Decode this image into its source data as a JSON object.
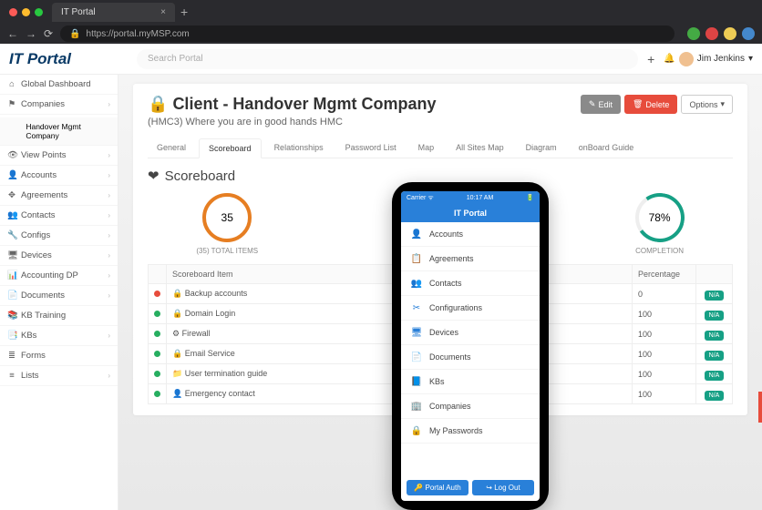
{
  "browser": {
    "tab_title": "IT Portal",
    "url": "https://portal.myMSP.com"
  },
  "header": {
    "logo": "IT Portal",
    "search_placeholder": "Search Portal",
    "add_label": "+",
    "user_name": "Jim Jenkins"
  },
  "sidebar": {
    "items": [
      {
        "icon": "⌂",
        "label": "Global Dashboard",
        "chev": false
      },
      {
        "icon": "⚑",
        "label": "Companies",
        "chev": true
      },
      {
        "icon": "",
        "label": "Handover Mgmt Company",
        "chev": false,
        "sub": true,
        "active": true
      },
      {
        "icon": "👁",
        "label": "View Points",
        "chev": true
      },
      {
        "icon": "👤",
        "label": "Accounts",
        "chev": true
      },
      {
        "icon": "✥",
        "label": "Agreements",
        "chev": true
      },
      {
        "icon": "👥",
        "label": "Contacts",
        "chev": true
      },
      {
        "icon": "🔧",
        "label": "Configs",
        "chev": true
      },
      {
        "icon": "🖥",
        "label": "Devices",
        "chev": true
      },
      {
        "icon": "📊",
        "label": "Accounting DP",
        "chev": true
      },
      {
        "icon": "📄",
        "label": "Documents",
        "chev": true
      },
      {
        "icon": "📚",
        "label": "KB Training",
        "chev": false
      },
      {
        "icon": "📑",
        "label": "KBs",
        "chev": true
      },
      {
        "icon": "≣",
        "label": "Forms",
        "chev": false
      },
      {
        "icon": "≡",
        "label": "Lists",
        "chev": true
      }
    ]
  },
  "page": {
    "lock_icon": "🔒",
    "title": "Client - Handover Mgmt Company",
    "subtitle": "(HMC3) Where you are in good hands HMC",
    "buttons": {
      "edit": "Edit",
      "delete": "Delete",
      "options": "Options"
    }
  },
  "tabs": [
    "General",
    "Scoreboard",
    "Relationships",
    "Password List",
    "Map",
    "All Sites Map",
    "Diagram",
    "onBoard Guide"
  ],
  "active_tab": 1,
  "scoreboard": {
    "heading": "Scoreboard",
    "total_value": "35",
    "total_label": "(35) TOTAL ITEMS",
    "completion_value": "78%",
    "completion_label": "COMPLETION",
    "columns": [
      "",
      "Scoreboard Item",
      "Percentage",
      ""
    ],
    "rows": [
      {
        "status": "red",
        "icon": "🔒",
        "name": "Backup accounts",
        "pct": "0",
        "badge": "N/A"
      },
      {
        "status": "green",
        "icon": "🔒",
        "name": "Domain Login",
        "pct": "100",
        "badge": "N/A"
      },
      {
        "status": "green",
        "icon": "⚙",
        "name": "Firewall",
        "pct": "100",
        "badge": "N/A"
      },
      {
        "status": "green",
        "icon": "🔒",
        "name": "Email Service",
        "pct": "100",
        "badge": "N/A"
      },
      {
        "status": "green",
        "icon": "📁",
        "name": "User termination guide",
        "pct": "100",
        "badge": "N/A"
      },
      {
        "status": "green",
        "icon": "👤",
        "name": "Emergency contact",
        "pct": "100",
        "badge": "N/A"
      }
    ]
  },
  "phone": {
    "carrier": "Carrier ᯤ",
    "time": "10:17 AM",
    "title": "IT Portal",
    "items": [
      {
        "icon": "👤",
        "label": "Accounts"
      },
      {
        "icon": "📋",
        "label": "Agreements"
      },
      {
        "icon": "👥",
        "label": "Contacts"
      },
      {
        "icon": "✂",
        "label": "Configurations"
      },
      {
        "icon": "🖥",
        "label": "Devices"
      },
      {
        "icon": "📄",
        "label": "Documents"
      },
      {
        "icon": "📘",
        "label": "KBs"
      },
      {
        "icon": "🏢",
        "label": "Companies"
      },
      {
        "icon": "🔒",
        "label": "My Passwords"
      }
    ],
    "btn1": "Portal Auth",
    "btn2": "Log Out"
  }
}
